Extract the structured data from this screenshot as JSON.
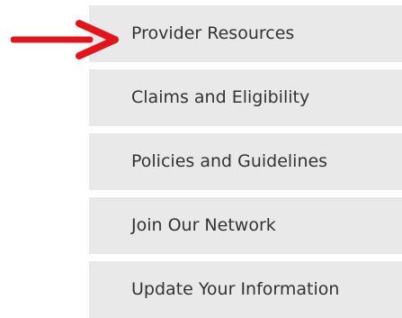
{
  "nav_menu": {
    "items": [
      {
        "label": "Provider Resources"
      },
      {
        "label": "Claims and Eligibility"
      },
      {
        "label": "Policies and Guidelines"
      },
      {
        "label": "Join Our Network"
      },
      {
        "label": "Update Your Information"
      }
    ]
  },
  "annotation": {
    "arrow_color": "#e3141b",
    "menu_background": "#e9e9e9",
    "menu_text_color": "#333333"
  }
}
